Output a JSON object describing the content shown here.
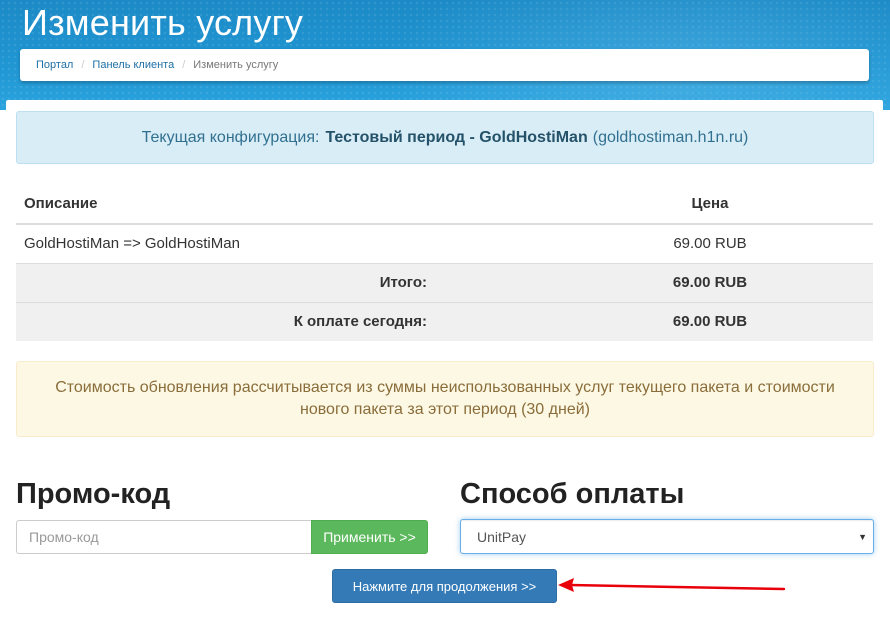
{
  "page": {
    "title": "Изменить услугу"
  },
  "breadcrumb": {
    "items": [
      "Портал",
      "Панель клиента",
      "Изменить услугу"
    ],
    "separator": "/"
  },
  "current_config": {
    "prefix": "Текущая конфигурация:",
    "product_name": "Тестовый период - GoldHostiMan",
    "domain": "(goldhostiman.h1n.ru)"
  },
  "summary_table": {
    "headers": {
      "description": "Описание",
      "price": "Цена"
    },
    "items": [
      {
        "description": "GoldHostiMan => GoldHostiMan",
        "price": "69.00 RUB"
      }
    ],
    "total_label": "Итого:",
    "total_value": "69.00 RUB",
    "due_today_label": "К оплате сегодня:",
    "due_today_value": "69.00 RUB"
  },
  "notice": {
    "text": "Стоимость обновления рассчитывается из суммы неиспользованных услуг текущего пакета и стоимости нового пакета за этот период (30 дней)"
  },
  "promo": {
    "heading": "Промо-код",
    "placeholder": "Промо-код",
    "value": "",
    "apply_label": "Применить >>"
  },
  "payment": {
    "heading": "Способ оплаты",
    "selected": "UnitPay"
  },
  "continue_button": {
    "label": "Нажмите для продолжения >>"
  },
  "colors": {
    "header_blue": "#1f95d2",
    "info_bg": "#d9edf7",
    "warning_bg": "#fcf8e3",
    "success_green": "#5cb85c",
    "primary_blue": "#337ab7",
    "annotation_red": "#e8000b"
  },
  "icons": {
    "select_caret": "caret-down-icon",
    "annotation": "red-arrow-icon"
  }
}
